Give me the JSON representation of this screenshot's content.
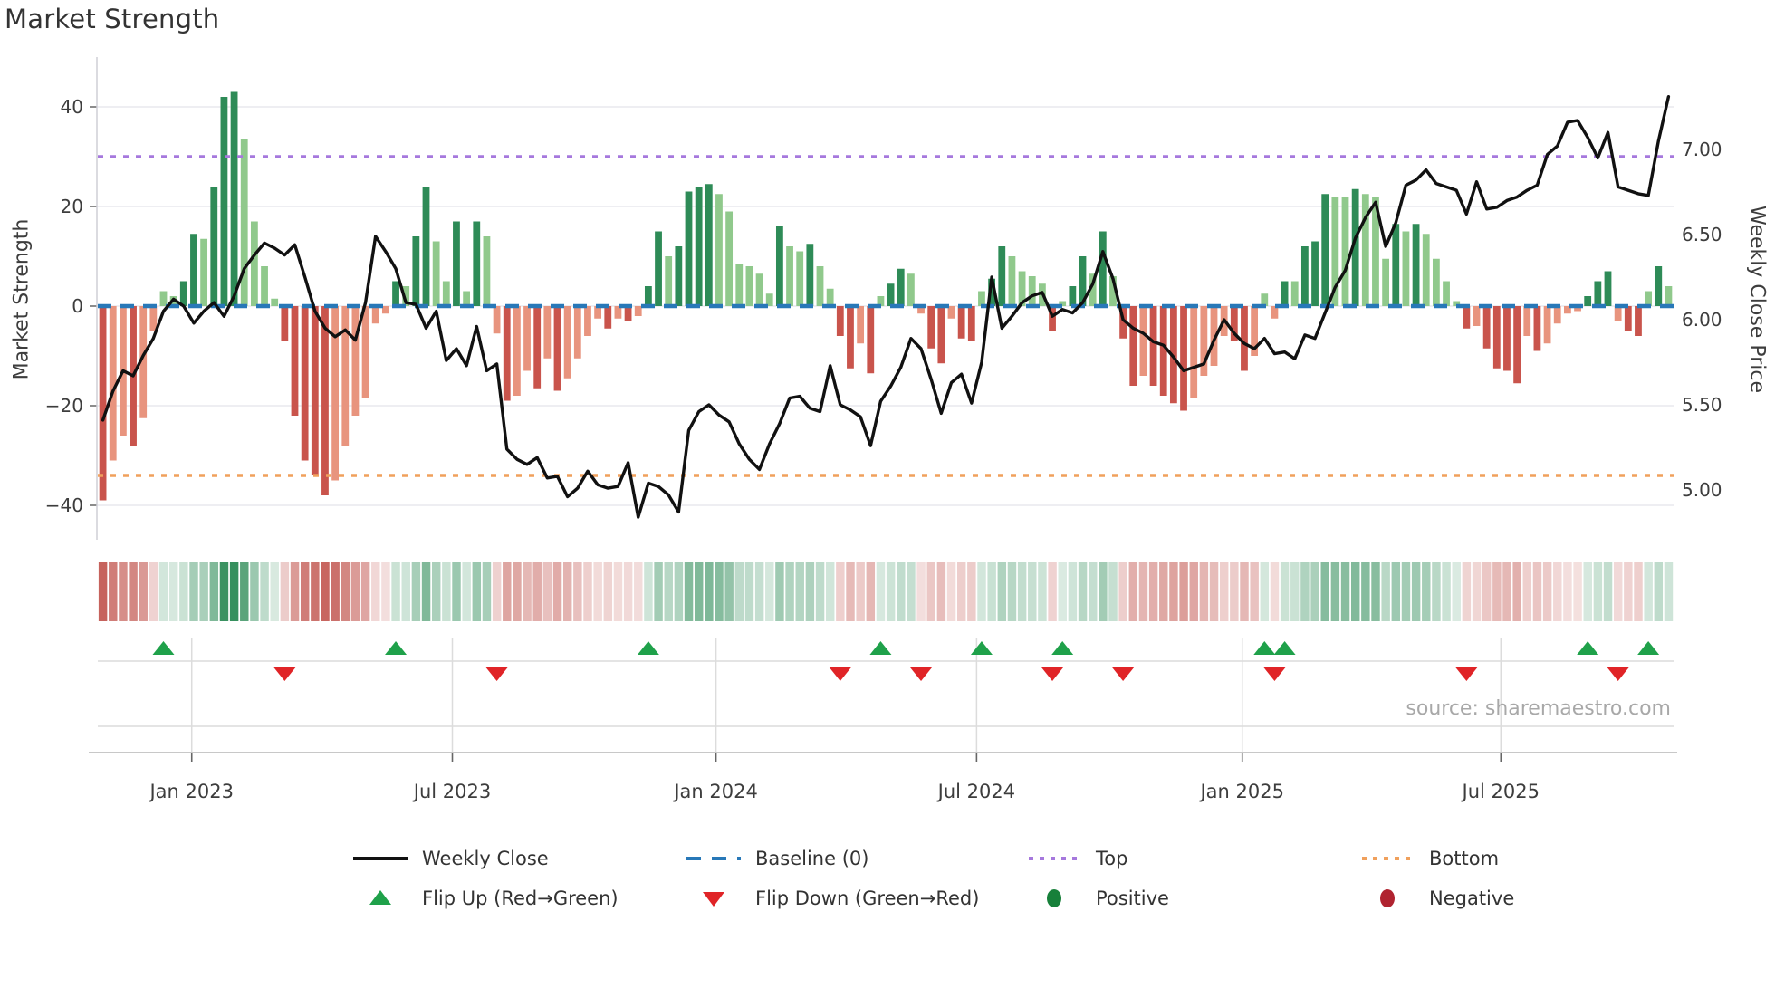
{
  "chart_data": {
    "type": "bar+line",
    "title": "Market Strength",
    "ylabel_left": "Market Strength",
    "ylabel_right": "Weekly Close Price",
    "source": "source: sharemaestro.com",
    "legend_position": "bottom",
    "grid": "horizontal-only",
    "ylim_strength": [
      -47,
      50
    ],
    "ylim_price": [
      4.71,
      7.54
    ],
    "yticks_left": [
      40,
      20,
      0,
      -20,
      -40
    ],
    "yticks_right": [
      "7.00",
      "6.50",
      "6.00",
      "5.50",
      "5.00"
    ],
    "yticks_right_values": [
      7.0,
      6.5,
      6.0,
      5.5,
      5.0
    ],
    "xticks": [
      {
        "week": 8.8,
        "label": "Jan 2023"
      },
      {
        "week": 34.6,
        "label": "Jul 2023"
      },
      {
        "week": 60.7,
        "label": "Jan 2024"
      },
      {
        "week": 86.5,
        "label": "Jul 2024"
      },
      {
        "week": 112.8,
        "label": "Jan 2025"
      },
      {
        "week": 138.4,
        "label": "Jul 2025"
      }
    ],
    "baseline": 0,
    "top_threshold": 30,
    "bottom_threshold": -34,
    "weeks": 156,
    "strength": [
      -39,
      -31,
      -26,
      -28,
      -22.5,
      -5,
      3,
      2,
      5,
      14.5,
      13.5,
      24,
      42,
      43,
      33.5,
      17,
      8,
      1.5,
      -7,
      -22,
      -31,
      -34,
      -38,
      -35,
      -28,
      -22,
      -18.5,
      -3.5,
      -1.5,
      5,
      4,
      14,
      24,
      13,
      5,
      17,
      3,
      17,
      14,
      -5.5,
      -19,
      -18,
      -13,
      -16.5,
      -10.5,
      -17,
      -14.5,
      -10.5,
      -6,
      -2.5,
      -4.5,
      -2.5,
      -3,
      -2,
      4,
      15,
      10,
      12,
      23,
      24,
      24.5,
      22.5,
      19,
      8.5,
      8,
      6.5,
      2.5,
      16,
      12,
      11,
      12.5,
      8,
      3.5,
      -6,
      -12.5,
      -7.5,
      -13.5,
      2,
      4.5,
      7.5,
      6.5,
      -1.5,
      -8.5,
      -11.5,
      -2.5,
      -6.5,
      -7,
      3,
      5.5,
      12,
      10,
      7,
      6,
      4.5,
      -5,
      1,
      4,
      10,
      6.5,
      15,
      6,
      -6.5,
      -16,
      -14,
      -16,
      -18,
      -19.5,
      -21,
      -18.5,
      -14,
      -12,
      -6,
      -7,
      -13,
      -10,
      2.5,
      -2.5,
      5,
      5,
      12,
      13,
      22.5,
      22,
      22,
      23.5,
      22.5,
      22,
      9.5,
      16.5,
      15,
      16.5,
      14.5,
      9.5,
      5,
      1,
      -4.5,
      -4,
      -8.5,
      -12.5,
      -13,
      -15.5,
      -6,
      -9,
      -7.5,
      -3.5,
      -1.5,
      -1,
      2,
      5,
      7,
      -3,
      -5,
      -6,
      3,
      8,
      4
    ],
    "weekly_close": [
      5.41,
      5.58,
      5.7,
      5.67,
      5.79,
      5.89,
      6.05,
      6.12,
      6.08,
      5.98,
      6.05,
      6.1,
      6.02,
      6.14,
      6.3,
      6.38,
      6.45,
      6.42,
      6.38,
      6.44,
      6.25,
      6.05,
      5.95,
      5.9,
      5.94,
      5.88,
      6.1,
      6.49,
      6.4,
      6.3,
      6.1,
      6.09,
      5.95,
      6.05,
      5.76,
      5.83,
      5.73,
      5.96,
      5.7,
      5.74,
      5.24,
      5.18,
      5.15,
      5.19,
      5.07,
      5.08,
      4.96,
      5.01,
      5.11,
      5.03,
      5.01,
      5.02,
      5.16,
      4.84,
      5.04,
      5.02,
      4.97,
      4.87,
      5.35,
      5.46,
      5.5,
      5.44,
      5.4,
      5.27,
      5.18,
      5.12,
      5.27,
      5.39,
      5.54,
      5.55,
      5.48,
      5.46,
      5.73,
      5.5,
      5.47,
      5.43,
      5.26,
      5.52,
      5.61,
      5.72,
      5.89,
      5.83,
      5.65,
      5.45,
      5.63,
      5.68,
      5.51,
      5.75,
      6.25,
      5.95,
      6.02,
      6.1,
      6.14,
      6.16,
      6.02,
      6.06,
      6.04,
      6.1,
      6.21,
      6.4,
      6.24,
      6.0,
      5.95,
      5.92,
      5.87,
      5.85,
      5.78,
      5.7,
      5.72,
      5.74,
      5.88,
      6.0,
      5.92,
      5.86,
      5.83,
      5.89,
      5.8,
      5.81,
      5.77,
      5.91,
      5.89,
      6.04,
      6.19,
      6.29,
      6.48,
      6.6,
      6.69,
      6.43,
      6.57,
      6.79,
      6.82,
      6.88,
      6.8,
      6.78,
      6.76,
      6.62,
      6.81,
      6.65,
      6.66,
      6.7,
      6.72,
      6.76,
      6.79,
      6.97,
      7.02,
      7.16,
      7.17,
      7.07,
      6.95,
      7.1,
      6.78,
      6.76,
      6.74,
      6.73,
      7.05,
      7.31
    ],
    "flip_up_weeks": [
      6,
      29,
      54,
      77,
      87,
      95,
      115,
      117,
      147,
      153
    ],
    "flip_down_weeks": [
      18,
      39,
      73,
      81,
      94,
      101,
      116,
      135,
      150
    ],
    "heatmap": {
      "source_series": "strength",
      "style": "diverging red-green strip, one cell per week"
    },
    "legend": [
      {
        "swatch": "line-black",
        "label": "Weekly Close"
      },
      {
        "swatch": "dashes-blue",
        "label": "Baseline (0)"
      },
      {
        "swatch": "dots-purple",
        "label": "Top"
      },
      {
        "swatch": "dots-orange",
        "label": "Bottom"
      },
      {
        "swatch": "triangle-up",
        "label": "Flip Up (Red→Green)"
      },
      {
        "swatch": "triangle-down",
        "label": "Flip Down (Green→Red)"
      },
      {
        "swatch": "circle-green",
        "label": "Positive"
      },
      {
        "swatch": "circle-darkred",
        "label": "Negative"
      }
    ],
    "colors": {
      "bar_positive_strong": "#2e8b57",
      "bar_positive_weak": "#90c98c",
      "bar_negative_strong": "#c9544c",
      "bar_negative_weak": "#e8947e",
      "baseline": "#2878b8",
      "top_line": "#a678dd",
      "bottom_line": "#f0a05c",
      "price_line": "#111111",
      "grid": "#e9e9ee",
      "spine": "#cfcfd6",
      "panel_line": "#dcdcdc",
      "axis_line": "#c8c8c8",
      "tick": "#666666",
      "flip_up": "#1fa14a",
      "flip_down": "#e02427",
      "positive_dot": "#17803a",
      "negative_dot": "#b02330",
      "text": "#3d3d3d",
      "muted_text": "#a8a8a8"
    }
  }
}
